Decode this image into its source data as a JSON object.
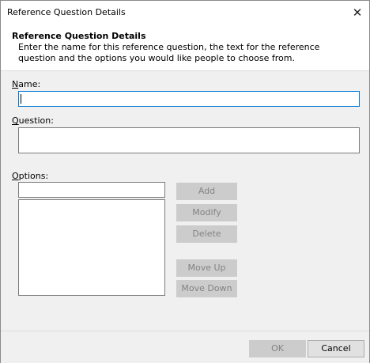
{
  "window": {
    "title": "Reference Question Details",
    "close_glyph": "✕"
  },
  "header": {
    "title": "Reference Question Details",
    "description": "Enter the name for this reference question, the text for the reference question and the options you would like people to choose from."
  },
  "form": {
    "name": {
      "label_mnemonic": "N",
      "label_rest": "ame:",
      "value": ""
    },
    "question": {
      "label_mnemonic": "Q",
      "label_rest": "uestion:",
      "value": ""
    },
    "options": {
      "label_mnemonic": "O",
      "label_rest": "ptions:",
      "input_value": "",
      "items": []
    }
  },
  "option_buttons": {
    "add": "Add",
    "modify": "Modify",
    "delete": "Delete",
    "move_up": "Move Up",
    "move_down": "Move Down"
  },
  "footer": {
    "ok": "OK",
    "cancel": "Cancel"
  }
}
